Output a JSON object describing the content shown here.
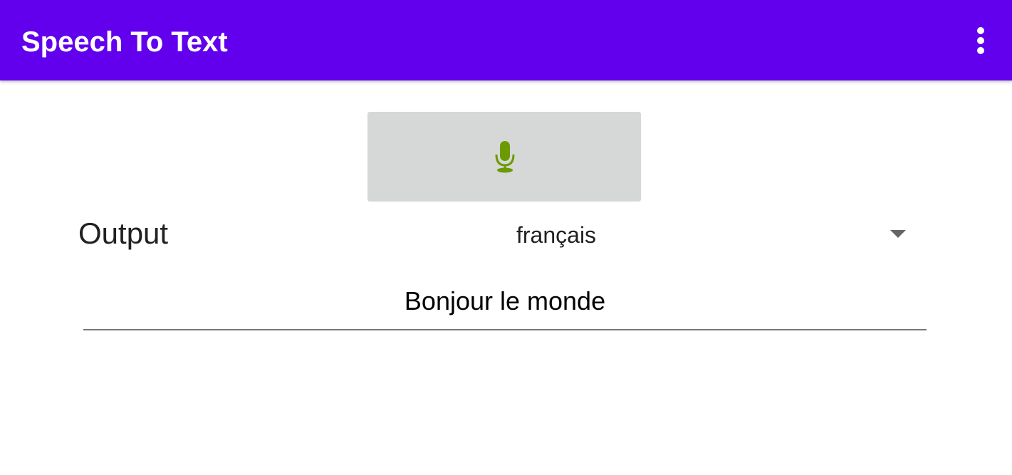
{
  "app": {
    "title": "Speech To Text",
    "accent_color": "#6200EE"
  },
  "toolbar": {
    "overflow_icon": "more-vertical-icon"
  },
  "mic_button": {
    "icon": "microphone-icon",
    "icon_color": "#6C9A00",
    "background_color": "#D6D7D7"
  },
  "output": {
    "label": "Output"
  },
  "language_select": {
    "selected": "français",
    "arrow_icon": "dropdown-arrow-icon"
  },
  "result": {
    "text": "Bonjour le monde"
  }
}
